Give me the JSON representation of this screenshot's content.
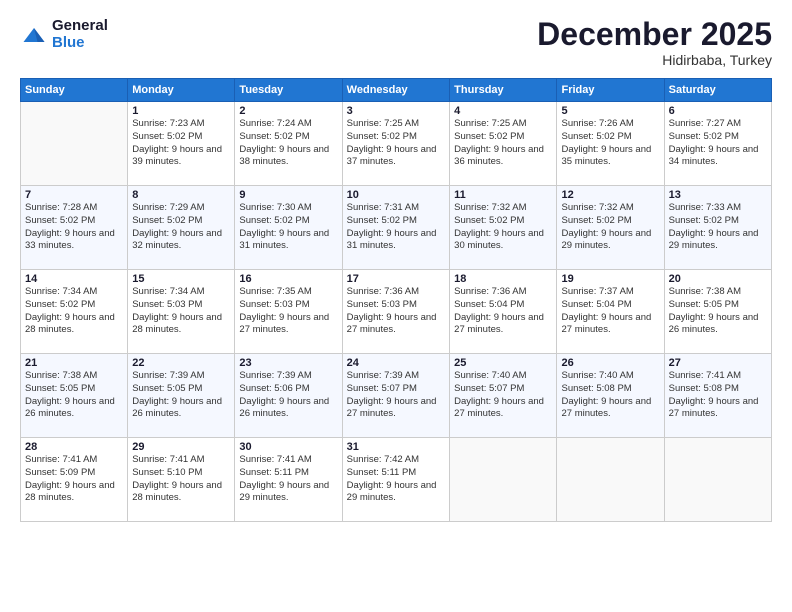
{
  "header": {
    "logo": {
      "line1": "General",
      "line2": "Blue"
    },
    "month": "December 2025",
    "location": "Hidirbaba, Turkey"
  },
  "weekdays": [
    "Sunday",
    "Monday",
    "Tuesday",
    "Wednesday",
    "Thursday",
    "Friday",
    "Saturday"
  ],
  "weeks": [
    [
      {
        "day": "",
        "info": ""
      },
      {
        "day": "1",
        "info": "Sunrise: 7:23 AM\nSunset: 5:02 PM\nDaylight: 9 hours\nand 39 minutes."
      },
      {
        "day": "2",
        "info": "Sunrise: 7:24 AM\nSunset: 5:02 PM\nDaylight: 9 hours\nand 38 minutes."
      },
      {
        "day": "3",
        "info": "Sunrise: 7:25 AM\nSunset: 5:02 PM\nDaylight: 9 hours\nand 37 minutes."
      },
      {
        "day": "4",
        "info": "Sunrise: 7:25 AM\nSunset: 5:02 PM\nDaylight: 9 hours\nand 36 minutes."
      },
      {
        "day": "5",
        "info": "Sunrise: 7:26 AM\nSunset: 5:02 PM\nDaylight: 9 hours\nand 35 minutes."
      },
      {
        "day": "6",
        "info": "Sunrise: 7:27 AM\nSunset: 5:02 PM\nDaylight: 9 hours\nand 34 minutes."
      }
    ],
    [
      {
        "day": "7",
        "info": "Sunrise: 7:28 AM\nSunset: 5:02 PM\nDaylight: 9 hours\nand 33 minutes."
      },
      {
        "day": "8",
        "info": "Sunrise: 7:29 AM\nSunset: 5:02 PM\nDaylight: 9 hours\nand 32 minutes."
      },
      {
        "day": "9",
        "info": "Sunrise: 7:30 AM\nSunset: 5:02 PM\nDaylight: 9 hours\nand 31 minutes."
      },
      {
        "day": "10",
        "info": "Sunrise: 7:31 AM\nSunset: 5:02 PM\nDaylight: 9 hours\nand 31 minutes."
      },
      {
        "day": "11",
        "info": "Sunrise: 7:32 AM\nSunset: 5:02 PM\nDaylight: 9 hours\nand 30 minutes."
      },
      {
        "day": "12",
        "info": "Sunrise: 7:32 AM\nSunset: 5:02 PM\nDaylight: 9 hours\nand 29 minutes."
      },
      {
        "day": "13",
        "info": "Sunrise: 7:33 AM\nSunset: 5:02 PM\nDaylight: 9 hours\nand 29 minutes."
      }
    ],
    [
      {
        "day": "14",
        "info": "Sunrise: 7:34 AM\nSunset: 5:02 PM\nDaylight: 9 hours\nand 28 minutes."
      },
      {
        "day": "15",
        "info": "Sunrise: 7:34 AM\nSunset: 5:03 PM\nDaylight: 9 hours\nand 28 minutes."
      },
      {
        "day": "16",
        "info": "Sunrise: 7:35 AM\nSunset: 5:03 PM\nDaylight: 9 hours\nand 27 minutes."
      },
      {
        "day": "17",
        "info": "Sunrise: 7:36 AM\nSunset: 5:03 PM\nDaylight: 9 hours\nand 27 minutes."
      },
      {
        "day": "18",
        "info": "Sunrise: 7:36 AM\nSunset: 5:04 PM\nDaylight: 9 hours\nand 27 minutes."
      },
      {
        "day": "19",
        "info": "Sunrise: 7:37 AM\nSunset: 5:04 PM\nDaylight: 9 hours\nand 27 minutes."
      },
      {
        "day": "20",
        "info": "Sunrise: 7:38 AM\nSunset: 5:05 PM\nDaylight: 9 hours\nand 26 minutes."
      }
    ],
    [
      {
        "day": "21",
        "info": "Sunrise: 7:38 AM\nSunset: 5:05 PM\nDaylight: 9 hours\nand 26 minutes."
      },
      {
        "day": "22",
        "info": "Sunrise: 7:39 AM\nSunset: 5:05 PM\nDaylight: 9 hours\nand 26 minutes."
      },
      {
        "day": "23",
        "info": "Sunrise: 7:39 AM\nSunset: 5:06 PM\nDaylight: 9 hours\nand 26 minutes."
      },
      {
        "day": "24",
        "info": "Sunrise: 7:39 AM\nSunset: 5:07 PM\nDaylight: 9 hours\nand 27 minutes."
      },
      {
        "day": "25",
        "info": "Sunrise: 7:40 AM\nSunset: 5:07 PM\nDaylight: 9 hours\nand 27 minutes."
      },
      {
        "day": "26",
        "info": "Sunrise: 7:40 AM\nSunset: 5:08 PM\nDaylight: 9 hours\nand 27 minutes."
      },
      {
        "day": "27",
        "info": "Sunrise: 7:41 AM\nSunset: 5:08 PM\nDaylight: 9 hours\nand 27 minutes."
      }
    ],
    [
      {
        "day": "28",
        "info": "Sunrise: 7:41 AM\nSunset: 5:09 PM\nDaylight: 9 hours\nand 28 minutes."
      },
      {
        "day": "29",
        "info": "Sunrise: 7:41 AM\nSunset: 5:10 PM\nDaylight: 9 hours\nand 28 minutes."
      },
      {
        "day": "30",
        "info": "Sunrise: 7:41 AM\nSunset: 5:11 PM\nDaylight: 9 hours\nand 29 minutes."
      },
      {
        "day": "31",
        "info": "Sunrise: 7:42 AM\nSunset: 5:11 PM\nDaylight: 9 hours\nand 29 minutes."
      },
      {
        "day": "",
        "info": ""
      },
      {
        "day": "",
        "info": ""
      },
      {
        "day": "",
        "info": ""
      }
    ]
  ]
}
